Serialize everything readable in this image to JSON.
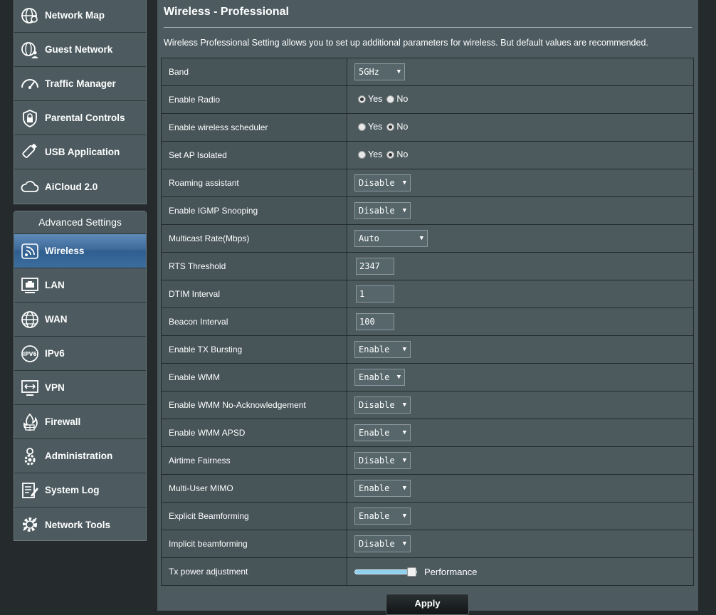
{
  "sidebar": {
    "general_items": [
      {
        "label": "Network Map",
        "icon": "globe-pin-icon"
      },
      {
        "label": "Guest Network",
        "icon": "guest-globe-icon"
      },
      {
        "label": "Traffic Manager",
        "icon": "speedometer-icon"
      },
      {
        "label": "Parental Controls",
        "icon": "shield-lock-icon"
      },
      {
        "label": "USB Application",
        "icon": "usb-stick-icon"
      },
      {
        "label": "AiCloud 2.0",
        "icon": "cloud-icon"
      }
    ],
    "advanced_header": "Advanced Settings",
    "advanced_items": [
      {
        "label": "Wireless",
        "icon": "wifi-icon",
        "active": true
      },
      {
        "label": "LAN",
        "icon": "lan-port-icon"
      },
      {
        "label": "WAN",
        "icon": "globe-icon"
      },
      {
        "label": "IPv6",
        "icon": "ipv6-icon"
      },
      {
        "label": "VPN",
        "icon": "vpn-monitor-icon"
      },
      {
        "label": "Firewall",
        "icon": "firewall-icon"
      },
      {
        "label": "Administration",
        "icon": "admin-gear-icon"
      },
      {
        "label": "System Log",
        "icon": "system-log-icon"
      },
      {
        "label": "Network Tools",
        "icon": "network-tools-icon"
      }
    ]
  },
  "main": {
    "title": "Wireless - Professional",
    "description": "Wireless Professional Setting allows you to set up additional parameters for wireless. But default values are recommended.",
    "apply_label": "Apply"
  },
  "settings": [
    {
      "label": "Band",
      "type": "select",
      "value": "5GHz"
    },
    {
      "label": "Enable Radio",
      "type": "radio",
      "value": "Yes"
    },
    {
      "label": "Enable wireless scheduler",
      "type": "radio",
      "value": "No"
    },
    {
      "label": "Set AP Isolated",
      "type": "radio",
      "value": "No"
    },
    {
      "label": "Roaming assistant",
      "type": "select",
      "value": "Disable"
    },
    {
      "label": "Enable IGMP Snooping",
      "type": "select",
      "value": "Disable"
    },
    {
      "label": "Multicast Rate(Mbps)",
      "type": "select",
      "value": "Auto"
    },
    {
      "label": "RTS Threshold",
      "type": "text",
      "value": "2347"
    },
    {
      "label": "DTIM Interval",
      "type": "text",
      "value": "1"
    },
    {
      "label": "Beacon Interval",
      "type": "text",
      "value": "100"
    },
    {
      "label": "Enable TX Bursting",
      "type": "select",
      "value": "Enable"
    },
    {
      "label": "Enable WMM",
      "type": "select",
      "value": "Enable"
    },
    {
      "label": "Enable WMM No-Acknowledgement",
      "type": "select",
      "value": "Disable"
    },
    {
      "label": "Enable WMM APSD",
      "type": "select",
      "value": "Enable"
    },
    {
      "label": "Airtime Fairness",
      "type": "select",
      "value": "Disable"
    },
    {
      "label": "Multi-User MIMO",
      "type": "select",
      "value": "Enable"
    },
    {
      "label": "Explicit Beamforming",
      "type": "select",
      "value": "Enable"
    },
    {
      "label": "Implicit beamforming",
      "type": "select",
      "value": "Disable"
    },
    {
      "label": "Tx power adjustment",
      "type": "slider",
      "value": 1.0,
      "value_text": "Performance"
    }
  ],
  "radio_options": [
    "Yes",
    "No"
  ]
}
